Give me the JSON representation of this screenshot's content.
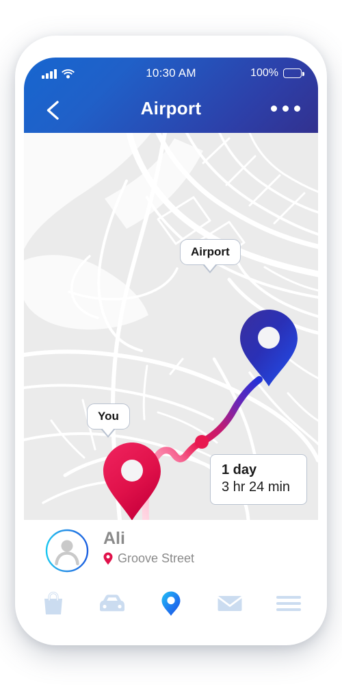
{
  "status_bar": {
    "signal_icon": "signal-bars-icon",
    "wifi_icon": "wifi-icon",
    "time": "10:30 AM",
    "battery_percent": "100%",
    "battery_icon": "battery-full-icon"
  },
  "header": {
    "back_icon": "chevron-left-icon",
    "title": "Airport",
    "more_icon": "more-options-icon",
    "gradient_from": "#1766cf",
    "gradient_to": "#32318f"
  },
  "map": {
    "background_color": "#ebebeb",
    "road_color": "#ffffff",
    "destination_callout": "Airport",
    "origin_callout": "You",
    "destination_pin_icon": "map-pin-destination-icon",
    "origin_pin_icon": "map-pin-origin-icon",
    "waypoint_icon": "route-waypoint-dot",
    "route_color_start": "#ffc5d6",
    "route_color_mid": "#e8184f",
    "route_color_end": "#2a2ecb",
    "destination_pin_color": "#2b2fbb",
    "origin_pin_color": "#e0114a",
    "duration_card": {
      "primary": "1 day",
      "secondary": "3 hr  24 min"
    }
  },
  "user": {
    "avatar_icon": "user-avatar-icon",
    "name": "Ali",
    "location_icon": "location-pin-icon",
    "address": "Groove Street",
    "name_color": "#8a8a8a",
    "pin_color": "#e0114a"
  },
  "tabbar": {
    "items": [
      {
        "icon": "shopping-bag-icon",
        "active": false
      },
      {
        "icon": "car-icon",
        "active": false
      },
      {
        "icon": "location-pin-icon",
        "active": true
      },
      {
        "icon": "envelope-icon",
        "active": false
      },
      {
        "icon": "hamburger-menu-icon",
        "active": false
      }
    ],
    "inactive_color": "#cbdcf0",
    "active_color": "#1e7cf5"
  }
}
